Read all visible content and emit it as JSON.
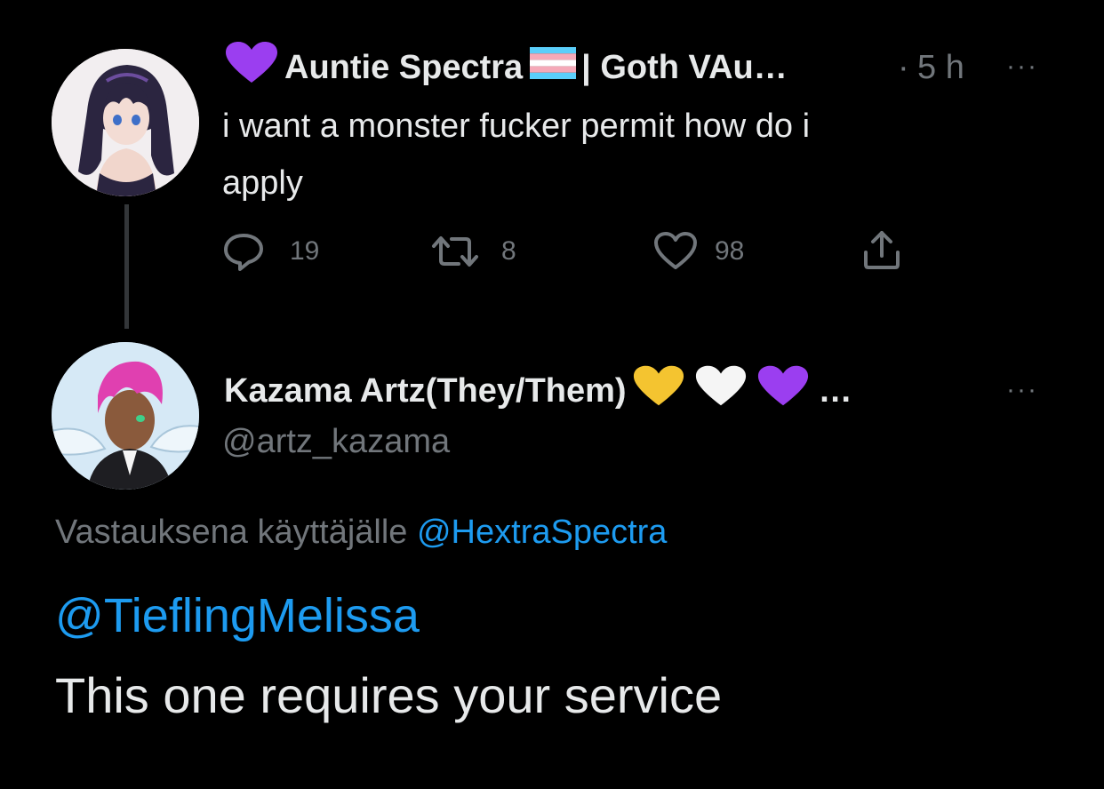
{
  "tweet1": {
    "display_name": "Auntie Spectra",
    "display_name_suffix": "| Goth VAu…",
    "separator": "·",
    "timestamp": "5 h",
    "text_line1": "i want a monster fucker permit how do i",
    "text_line2": "apply",
    "replies": "19",
    "retweets": "8",
    "likes": "98",
    "more": "···"
  },
  "tweet2": {
    "display_name": "Kazama Artz(They/Them)",
    "name_ellipsis": "…",
    "handle": "@artz_kazama",
    "more": "···",
    "reply_context_prefix": "Vastauksena käyttäjälle",
    "reply_context_handle": "@HextraSpectra",
    "mention": "@TieflingMelissa",
    "text": "This one requires your service"
  },
  "colors": {
    "background": "#000000",
    "text": "#e7e9ea",
    "muted": "#71767b",
    "link": "#1d9bf0",
    "purple_heart": "#9b3ef0",
    "yellow_heart": "#f4c430",
    "white_heart": "#f5f5f5"
  },
  "icons": {
    "reply": "reply-icon",
    "retweet": "retweet-icon",
    "like": "like-icon",
    "share": "share-icon"
  }
}
